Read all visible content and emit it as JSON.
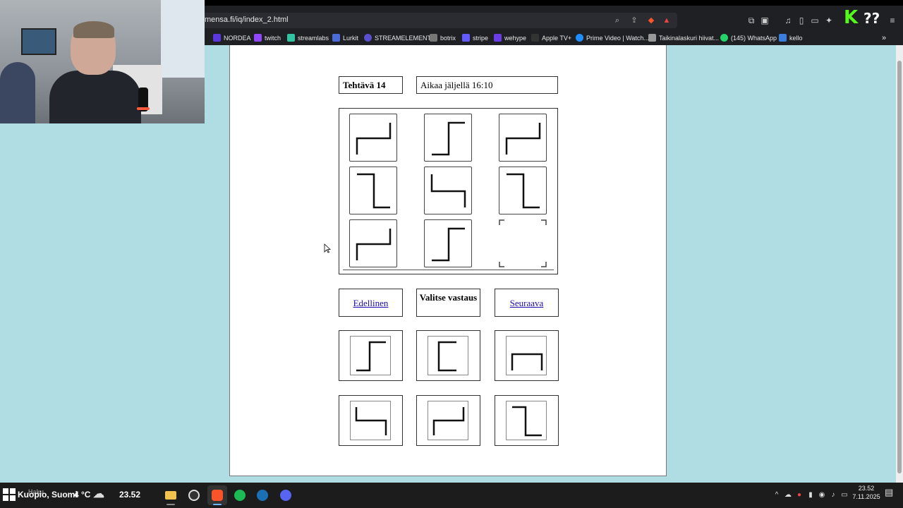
{
  "browser": {
    "url": "mensa.fi/iq/index_2.html",
    "bookmarks": [
      {
        "label": "NORDEA",
        "icon": "nordea-icon",
        "color": "#5b37e0"
      },
      {
        "label": "twitch",
        "icon": "twitch-icon",
        "color": "#9146ff"
      },
      {
        "label": "streamlabs",
        "icon": "streamlabs-icon",
        "color": "#31c3a2"
      },
      {
        "label": "Lurkit",
        "icon": "lurkit-icon",
        "color": "#4a6bd8"
      },
      {
        "label": "STREAMELEMENTS",
        "icon": "streamelements-icon",
        "color": "#5a4fcf"
      },
      {
        "label": "botrix",
        "icon": "botrix-icon",
        "color": "#777777"
      },
      {
        "label": "stripe",
        "icon": "stripe-icon",
        "color": "#635bff"
      },
      {
        "label": "wehype",
        "icon": "wehype-icon",
        "color": "#6a3de8"
      },
      {
        "label": "Apple TV+",
        "icon": "appletv-icon",
        "color": "#333333"
      },
      {
        "label": "Prime Video | Watch...",
        "icon": "prime-video-icon",
        "color": "#1f8fff"
      },
      {
        "label": "Taikinalaskuri hiivat...",
        "icon": "taikinalaskuri-icon",
        "color": "#999999"
      },
      {
        "label": "(145) WhatsApp",
        "icon": "whatsapp-icon",
        "color": "#25d366"
      },
      {
        "label": "kello",
        "icon": "kello-icon",
        "color": "#3b7ddd"
      }
    ],
    "overlay": {
      "kick": "K",
      "question": "??"
    }
  },
  "page": {
    "task_label": "Tehtävä 14",
    "timer_text": "Aikaa jäljellä 16:10",
    "prev_label": "Edellinen",
    "choose_label": "Valitse vastaus",
    "next_label": "Seuraava"
  },
  "taskbar": {
    "weather_location": "Kuopio, Suomi",
    "weather_temp": "4 °C",
    "taskbar_time": "23.52",
    "clock_time": "23.52",
    "clock_date": "7.11.2025",
    "search_hint": "Haku"
  }
}
